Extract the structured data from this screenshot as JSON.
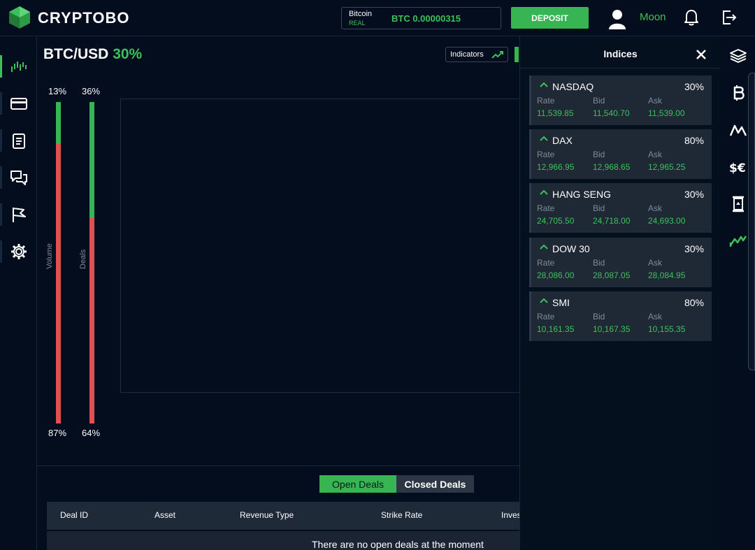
{
  "header": {
    "brand": "CRYPTOBO",
    "wallet": {
      "name": "Bitcoin",
      "type": "REAL",
      "balance": "BTC 0.00000315"
    },
    "deposit_label": "DEPOSIT",
    "username": "Moon"
  },
  "trade": {
    "pair": "BTC/USD",
    "pair_pct": "30%",
    "indicators_label": "Indicators",
    "volume": {
      "label": "Volume",
      "top": "13%",
      "bottom": "87%",
      "fill": 0.13
    },
    "deals": {
      "label": "Deals",
      "top": "36%",
      "bottom": "64%",
      "fill": 0.36
    }
  },
  "deals_table": {
    "tabs": {
      "open": "Open Deals",
      "closed": "Closed Deals"
    },
    "columns": [
      "Deal ID",
      "Asset",
      "Revenue Type",
      "Strike Rate",
      "Inves"
    ],
    "empty_text": "There are no open deals at the moment"
  },
  "indices": {
    "title": "Indices",
    "labels": {
      "rate": "Rate",
      "bid": "Bid",
      "ask": "Ask"
    },
    "items": [
      {
        "name": "NASDAQ",
        "pct": "30%",
        "rate": "11,539.85",
        "bid": "11,540.70",
        "ask": "11,539.00"
      },
      {
        "name": "DAX",
        "pct": "80%",
        "rate": "12,966.95",
        "bid": "12,968.65",
        "ask": "12,965.25"
      },
      {
        "name": "HANG SENG",
        "pct": "30%",
        "rate": "24,705.50",
        "bid": "24,718.00",
        "ask": "24,693.00"
      },
      {
        "name": "DOW 30",
        "pct": "30%",
        "rate": "28,086.00",
        "bid": "28,087.05",
        "ask": "28,084.95"
      },
      {
        "name": "SMI",
        "pct": "80%",
        "rate": "10,161.35",
        "bid": "10,167.35",
        "ask": "10,155.35"
      }
    ]
  },
  "colors": {
    "accent": "#38b553",
    "down": "#e0504c",
    "background": "#030d1d",
    "card": "#1f2936"
  },
  "icons": {
    "sidebar": [
      "chart-bars-icon",
      "credit-card-icon",
      "clipboard-icon",
      "chat-icon",
      "flag-icon",
      "gear-icon"
    ],
    "rail": [
      "layers-icon",
      "bitcoin-icon",
      "activity-icon",
      "currency-icon",
      "commodity-icon",
      "trend-icon"
    ]
  }
}
